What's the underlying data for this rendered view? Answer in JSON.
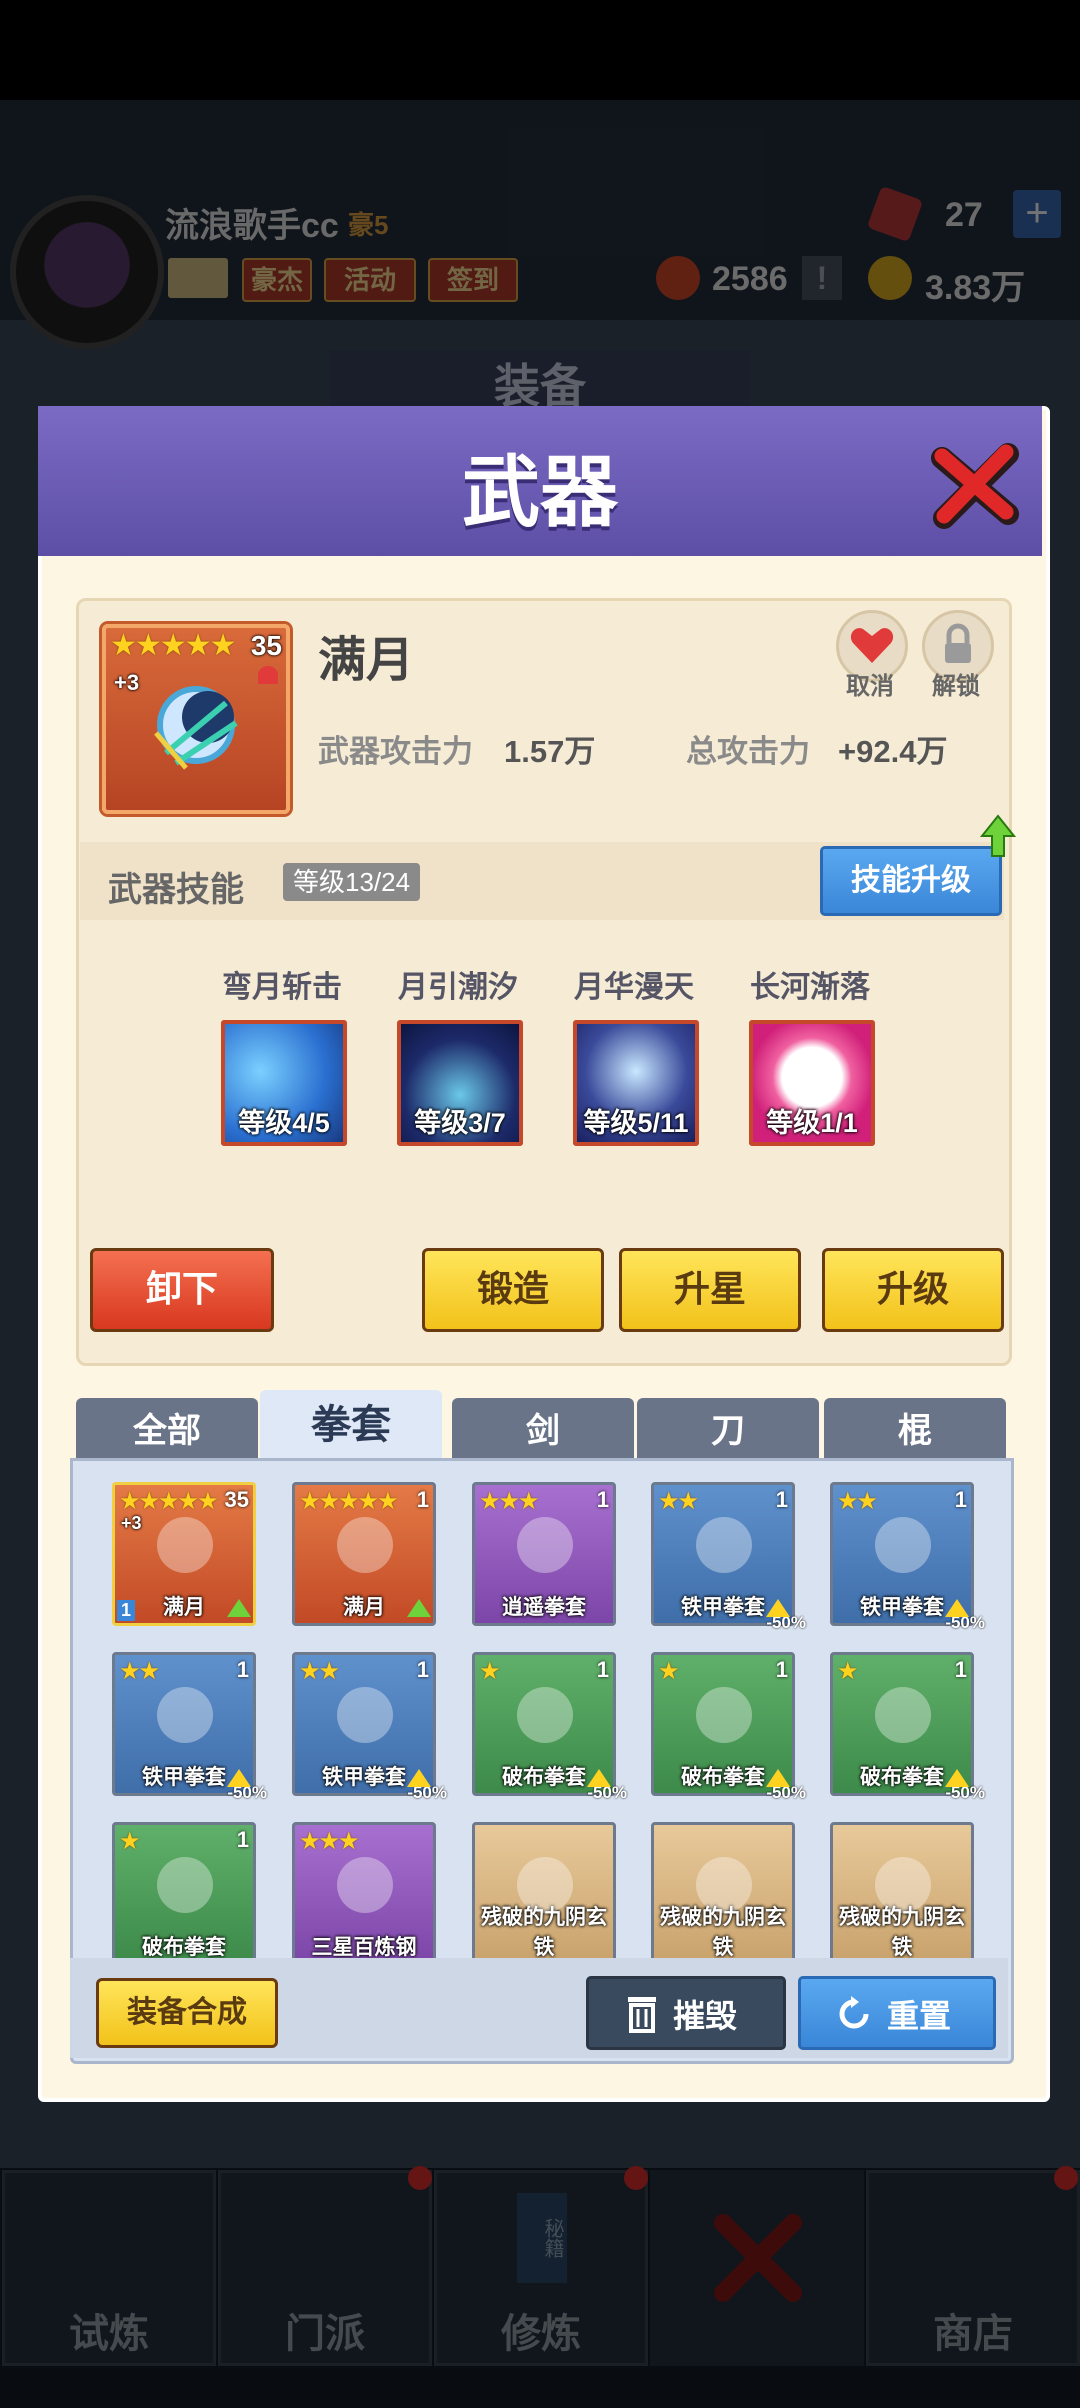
{
  "player": {
    "name": "流浪歌手cc",
    "rank": "豪5",
    "tags": [
      "豪杰",
      "活动",
      "签到"
    ]
  },
  "resources": {
    "gems": "27",
    "tokens": "2586",
    "gold": "3.83万",
    "plus": "+",
    "alert": "!"
  },
  "background": {
    "banner": "装备",
    "nav": [
      "试炼",
      "门派",
      "修炼",
      "",
      "商店"
    ],
    "nav_book": "秘籍"
  },
  "dialog": {
    "title": "武器"
  },
  "weapon": {
    "name": "满月",
    "stars": "★★★★★",
    "level": "35",
    "plus": "+3",
    "attack_label": "武器攻击力",
    "attack_value": "1.57万",
    "total_label": "总攻击力",
    "total_value": "+92.4万",
    "cancel_label": "取消",
    "unlock_label": "解锁"
  },
  "skills": {
    "title": "武器技能",
    "level": "等级13/24",
    "upgrade_label": "技能升级",
    "items": [
      {
        "name": "弯月斩击",
        "level": "等级4/5",
        "color": "#2a6fd0"
      },
      {
        "name": "月引潮汐",
        "level": "等级3/7",
        "color": "#1d2a6a"
      },
      {
        "name": "月华漫天",
        "level": "等级5/11",
        "color": "#3a4a9a"
      },
      {
        "name": "长河渐落",
        "level": "等级1/1",
        "color": "#d0207a"
      }
    ]
  },
  "actions": {
    "unequip": "卸下",
    "forge": "锻造",
    "star_up": "升星",
    "upgrade": "升级"
  },
  "tabs": [
    "全部",
    "拳套",
    "剑",
    "刀",
    "棍"
  ],
  "active_tab": 1,
  "inventory": [
    {
      "name": "满月",
      "stars": "★★★★★",
      "count": "35",
      "type": "orange",
      "badge": "",
      "plus": "+3",
      "slot": "1"
    },
    {
      "name": "满月",
      "stars": "★★★★★",
      "count": "1",
      "type": "orange",
      "badge": "",
      "plus": "",
      "slot": ""
    },
    {
      "name": "逍遥拳套",
      "stars": "★★★",
      "count": "1",
      "type": "purple",
      "badge": "",
      "plus": "",
      "slot": ""
    },
    {
      "name": "铁甲拳套",
      "stars": "★★",
      "count": "1",
      "type": "blue",
      "badge": "-50%",
      "plus": "",
      "slot": ""
    },
    {
      "name": "铁甲拳套",
      "stars": "★★",
      "count": "1",
      "type": "blue",
      "badge": "-50%",
      "plus": "",
      "slot": ""
    },
    {
      "name": "铁甲拳套",
      "stars": "★★",
      "count": "1",
      "type": "blue",
      "badge": "-50%",
      "plus": "",
      "slot": ""
    },
    {
      "name": "铁甲拳套",
      "stars": "★★",
      "count": "1",
      "type": "blue",
      "badge": "-50%",
      "plus": "",
      "slot": ""
    },
    {
      "name": "破布拳套",
      "stars": "★",
      "count": "1",
      "type": "green",
      "badge": "-50%",
      "plus": "",
      "slot": ""
    },
    {
      "name": "破布拳套",
      "stars": "★",
      "count": "1",
      "type": "green",
      "badge": "-50%",
      "plus": "",
      "slot": ""
    },
    {
      "name": "破布拳套",
      "stars": "★",
      "count": "1",
      "type": "green",
      "badge": "-50%",
      "plus": "",
      "slot": ""
    },
    {
      "name": "破布拳套",
      "stars": "★",
      "count": "1",
      "type": "green",
      "badge": "",
      "plus": "",
      "slot": ""
    },
    {
      "name": "三星百炼钢",
      "stars": "★★★",
      "count": "",
      "type": "purple",
      "badge": "",
      "plus": "",
      "slot": ""
    },
    {
      "name": "残破的九阴玄铁",
      "stars": "",
      "count": "",
      "type": "tan",
      "badge": "",
      "plus": "",
      "slot": ""
    },
    {
      "name": "残破的九阴玄铁",
      "stars": "",
      "count": "",
      "type": "tan",
      "badge": "",
      "plus": "",
      "slot": ""
    },
    {
      "name": "残破的九阴玄铁",
      "stars": "",
      "count": "",
      "type": "tan",
      "badge": "",
      "plus": "",
      "slot": ""
    }
  ],
  "footer": {
    "synthesize": "装备合成",
    "destroy": "摧毁",
    "reset": "重置"
  }
}
